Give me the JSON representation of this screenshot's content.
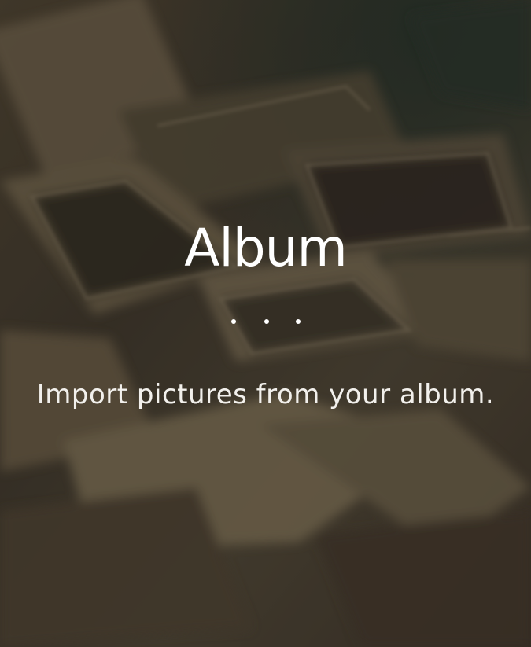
{
  "screen": {
    "title": "Album",
    "subtitle": "Import pictures from your album.",
    "page_dots": 3,
    "background_icon": "scattered-photos-background",
    "colors": {
      "text": "#ffffff",
      "overlay": "#2f2a22"
    }
  }
}
